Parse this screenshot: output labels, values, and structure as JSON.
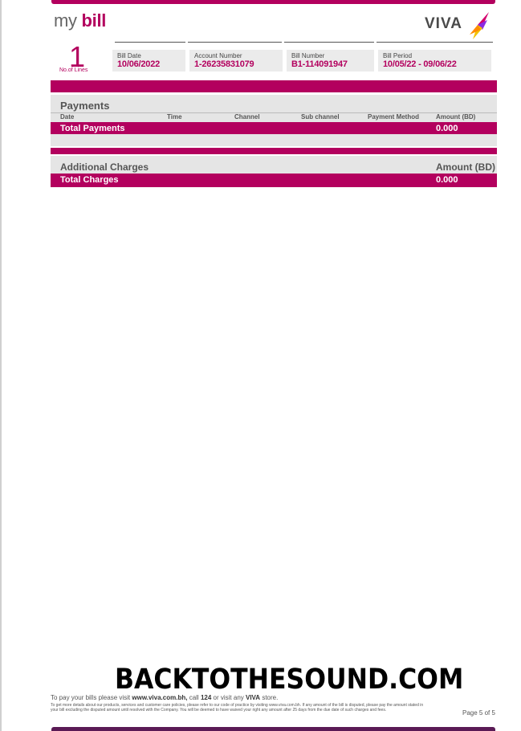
{
  "header": {
    "title_my": "my",
    "title_bill": "bill",
    "logo_text": "VIVA"
  },
  "summary": {
    "lines_count": "1",
    "lines_label": "No.of Lines",
    "bill_date_label": "Bill Date",
    "bill_date": "10/06/2022",
    "account_label": "Account Number",
    "account_number": "1-26235831079",
    "bill_number_label": "Bill Number",
    "bill_number": "B1-114091947",
    "bill_period_label": "Bill Period",
    "bill_period": "10/05/22 - 09/06/22"
  },
  "payments": {
    "title": "Payments",
    "columns": [
      "Date",
      "Time",
      "Channel",
      "Sub channel",
      "Payment Method",
      "Amount (BD)"
    ],
    "total_label": "Total Payments",
    "total_value": "0.000"
  },
  "additional": {
    "title": "Additional Charges",
    "amount_header": "Amount (BD)",
    "total_label": "Total Charges",
    "total_value": "0.000"
  },
  "watermark": "BACKTOTHESOUND.COM",
  "footer": {
    "pay_prefix": "To pay your bills please visit",
    "pay_site": "www.viva.com.bh,",
    "pay_call": "call",
    "pay_number": "124",
    "pay_or": "or visit any",
    "pay_brand": "VIVA",
    "pay_suffix": "store.",
    "fine_print": "To get more details about our products, services and customer care policies, please refer to our code of practice by visiting www.viva.com.bh. If any amount of the bill is disputed, please pay the amount stated in your bill excluding the disputed amount until resolved with the Company. You will be deemed to have waived your right any amount after 25 days from the due date of such charges and fees.",
    "page": "Page 5 of 5"
  },
  "colors": {
    "brand_magenta": "#b3005e",
    "band_grey": "#e5e5e5",
    "bottom_purple": "#5a1a55"
  }
}
